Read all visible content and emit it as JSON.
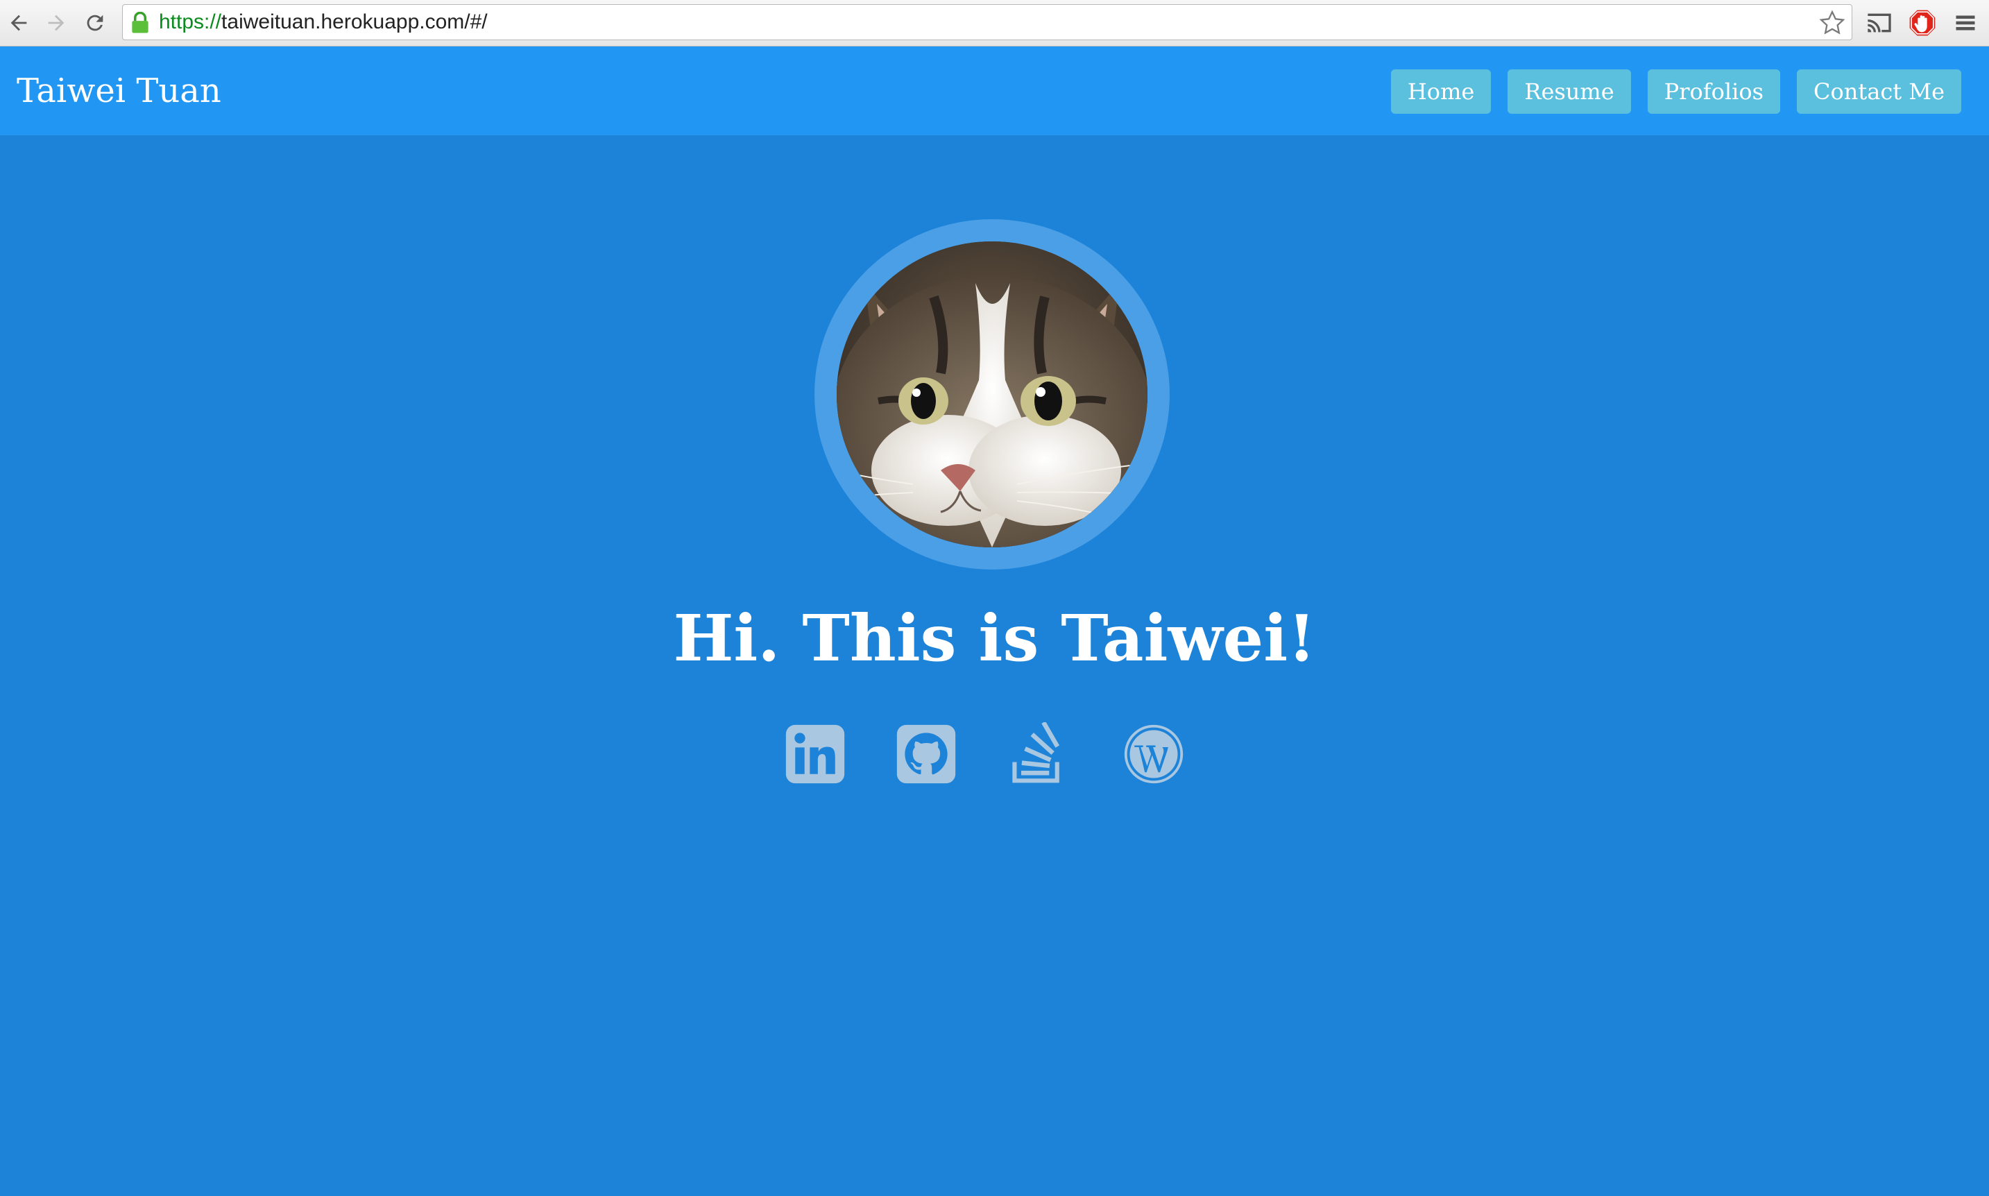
{
  "browser": {
    "url_scheme": "https://",
    "url_rest": "taiweituan.herokuapp.com/#/"
  },
  "header": {
    "brand": "Taiwei Tuan",
    "nav": [
      "Home",
      "Resume",
      "Profolios",
      "Contact Me"
    ]
  },
  "hero": {
    "headline": "Hi. This is Taiwei!",
    "social_icons": [
      "linkedin-icon",
      "github-icon",
      "stackoverflow-icon",
      "wordpress-icon"
    ]
  },
  "colors": {
    "page_bg": "#1c83d8",
    "header_bg": "#2196f3",
    "nav_button_bg": "#5bc0de",
    "avatar_ring": "#4a9fe6",
    "social_icon": "#a9c7e0"
  }
}
